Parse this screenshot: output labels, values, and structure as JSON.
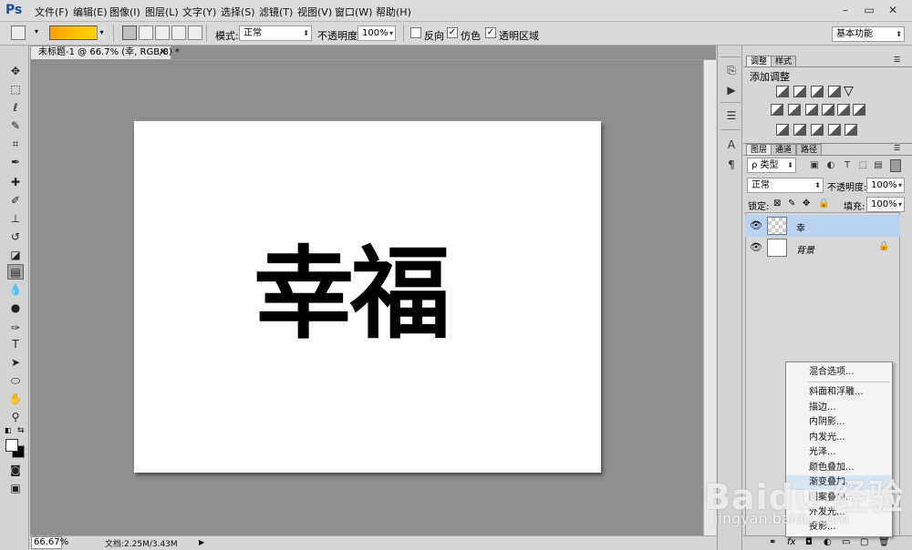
{
  "app": {
    "logo": "Ps"
  },
  "menu": [
    "文件(F)",
    "编辑(E)",
    "图像(I)",
    "图层(L)",
    "文字(Y)",
    "选择(S)",
    "滤镜(T)",
    "视图(V)",
    "窗口(W)",
    "帮助(H)"
  ],
  "window_controls": {
    "minimize": "–",
    "restore": "▭",
    "close": "✕"
  },
  "options": {
    "mode_label": "模式:",
    "mode_value": "正常",
    "opacity_label": "不透明度:",
    "opacity_value": "100%",
    "reverse_label": "反向",
    "dither_label": "仿色",
    "transparency_label": "透明区域",
    "reverse_checked": false,
    "dither_checked": true,
    "transparency_checked": true,
    "workspace": "基本功能"
  },
  "document": {
    "tab_title": "未标题-1 @ 66.7% (幸, RGB/8) *",
    "canvas_text": "幸福",
    "zoom": "66.67%",
    "info": "文档:2.25M/3.43M"
  },
  "panels": {
    "adjust_tabs": [
      "调整",
      "样式"
    ],
    "adjust_title": "添加调整",
    "layer_tabs": [
      "图层",
      "通道",
      "路径"
    ],
    "filter_value": "ρ 类型",
    "blend_mode": "正常",
    "opacity_label": "不透明度:",
    "opacity_value": "100%",
    "lock_label": "锁定:",
    "fill_label": "填充:",
    "fill_value": "100%",
    "layers": [
      {
        "name": "幸",
        "selected": true,
        "locked": false
      },
      {
        "name": "背景",
        "selected": false,
        "locked": true
      }
    ]
  },
  "context_menu": {
    "items": [
      "混合选项...",
      "斜面和浮雕...",
      "描边...",
      "内阴影...",
      "内发光...",
      "光泽...",
      "颜色叠加...",
      "渐变叠加...",
      "图案叠加...",
      "外发光...",
      "投影..."
    ],
    "highlighted_index": 7
  },
  "watermark": {
    "logo": "Baidu 经验",
    "url": "jingyan.baidu.com"
  },
  "colors": {
    "accent_selection": "#b9d2f0",
    "gradient_start": "#ffa000",
    "gradient_end": "#ffe000"
  }
}
